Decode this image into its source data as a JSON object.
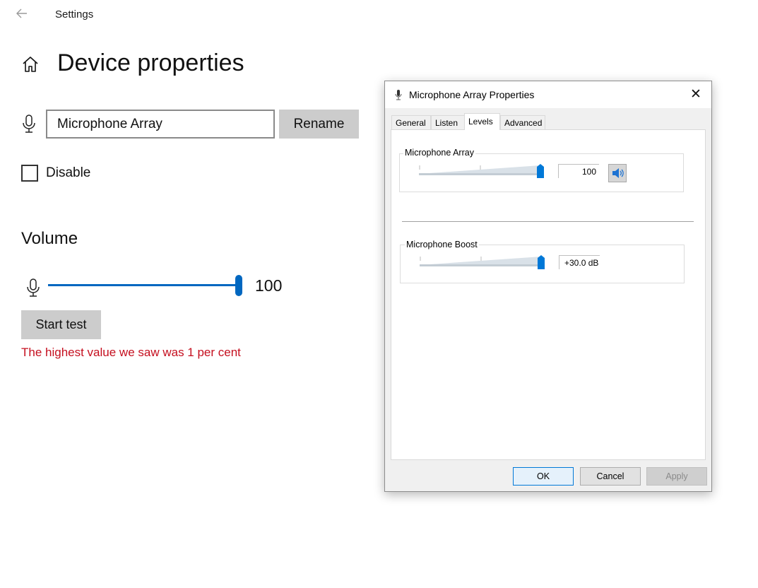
{
  "settings": {
    "app_title": "Settings",
    "page_title": "Device properties",
    "device_name_value": "Microphone Array",
    "rename_label": "Rename",
    "disable_label": "Disable",
    "disable_checked": false,
    "volume_title": "Volume",
    "volume_value": "100",
    "start_test_label": "Start test",
    "test_result": "The highest value we saw was 1 per cent",
    "accent_color": "#0067c0",
    "error_color": "#c50f1f"
  },
  "dialog": {
    "title": "Microphone Array Properties",
    "close_label": "✕",
    "tabs": [
      {
        "label": "General",
        "active": false
      },
      {
        "label": "Listen",
        "active": false
      },
      {
        "label": "Levels",
        "active": true
      },
      {
        "label": "Advanced",
        "active": false
      }
    ],
    "levels": {
      "mic_label": "Microphone Array",
      "mic_value": "100",
      "mic_level_fraction": 1.0,
      "boost_label": "Microphone Boost",
      "boost_value": "+30.0 dB",
      "boost_level_fraction": 1.0
    },
    "buttons": {
      "ok": "OK",
      "cancel": "Cancel",
      "apply": "Apply"
    }
  },
  "icons": {
    "back": "back-arrow-icon",
    "home": "home-icon",
    "mic": "microphone-icon",
    "speaker": "speaker-icon",
    "close": "close-icon"
  }
}
